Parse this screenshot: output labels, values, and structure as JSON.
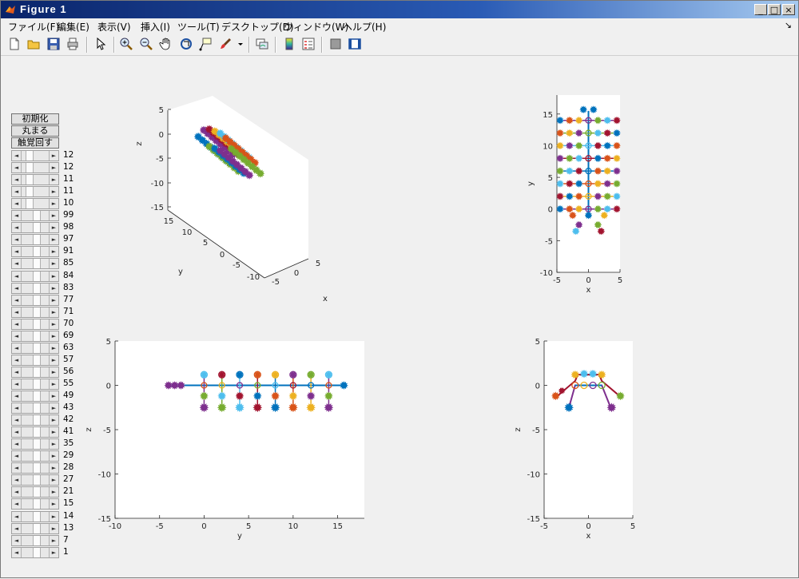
{
  "window": {
    "title": "Figure 1",
    "minimize_label": "_",
    "maximize_label": "□",
    "close_label": "×"
  },
  "menu": {
    "items": [
      {
        "label": "ファイル(F)"
      },
      {
        "label": "編集(E)"
      },
      {
        "label": "表示(V)"
      },
      {
        "label": "挿入(I)"
      },
      {
        "label": "ツール(T)"
      },
      {
        "label": "デスクトップ(D)"
      },
      {
        "label": "ウィンドウ(W)"
      },
      {
        "label": "ヘルプ(H)"
      }
    ],
    "dock_label": "↘"
  },
  "toolbar": {
    "tools": [
      "new-figure-icon",
      "open-icon",
      "save-icon",
      "print-icon",
      "pointer-icon",
      "zoom-in-icon",
      "zoom-out-icon",
      "pan-hand-icon",
      "rotate-3d-icon",
      "data-cursor-icon",
      "brush-icon",
      "link-plot-icon",
      "colorbar-icon",
      "legend-icon",
      "hide-plot-tools-icon",
      "show-plot-tools-icon"
    ]
  },
  "controls": {
    "buttons": [
      {
        "label": "初期化"
      },
      {
        "label": "丸まる"
      },
      {
        "label": "触覚回す"
      }
    ],
    "slider_values": [
      "12",
      "12",
      "11",
      "11",
      "10",
      "99",
      "98",
      "97",
      "91",
      "85",
      "84",
      "83",
      "77",
      "71",
      "70",
      "69",
      "63",
      "57",
      "56",
      "55",
      "49",
      "43",
      "42",
      "41",
      "35",
      "29",
      "28",
      "27",
      "21",
      "15",
      "14",
      "13",
      "7",
      "1"
    ],
    "arrow_left": "◄",
    "arrow_right": "►"
  },
  "colors": {
    "accent": "#0a246a",
    "series": [
      "#0072BD",
      "#D95319",
      "#EDB120",
      "#7E2F8E",
      "#77AC30",
      "#4DBEEE",
      "#A2142F"
    ]
  },
  "chart_data": [
    {
      "type": "scatter",
      "view": "3d",
      "xlabel": "x",
      "ylabel": "y",
      "zlabel": "z",
      "xlim": [
        -5,
        5
      ],
      "ylim": [
        -10,
        15
      ],
      "zlim": [
        -15,
        5
      ],
      "xticks": [
        "-5",
        "0",
        "5"
      ],
      "yticks": [
        "-10",
        "-5",
        "0",
        "5",
        "10",
        "15"
      ],
      "zticks": [
        "-15",
        "-10",
        "-5",
        "0",
        "5"
      ],
      "grid": false,
      "legend": "none"
    },
    {
      "type": "scatter",
      "view": "top",
      "xlabel": "x",
      "ylabel": "y",
      "xlim": [
        -5,
        5
      ],
      "ylim": [
        -10,
        18
      ],
      "xticks": [
        "-5",
        "0",
        "5"
      ],
      "yticks": [
        "-10",
        "-5",
        "0",
        "5",
        "10",
        "15"
      ],
      "grid": false,
      "legend": "none"
    },
    {
      "type": "scatter",
      "view": "side",
      "xlabel": "y",
      "ylabel": "z",
      "xlim": [
        -10,
        18
      ],
      "ylim": [
        -15,
        5
      ],
      "xticks": [
        "-10",
        "-5",
        "0",
        "5",
        "10",
        "15"
      ],
      "yticks": [
        "-15",
        "-10",
        "-5",
        "0",
        "5"
      ],
      "grid": false,
      "legend": "none"
    },
    {
      "type": "scatter",
      "view": "front",
      "xlabel": "x",
      "ylabel": "z",
      "xlim": [
        -5,
        5
      ],
      "ylim": [
        -15,
        5
      ],
      "xticks": [
        "-5",
        "0",
        "5"
      ],
      "yticks": [
        "-15",
        "-10",
        "-5",
        "0",
        "5"
      ],
      "grid": false,
      "legend": "none"
    }
  ]
}
